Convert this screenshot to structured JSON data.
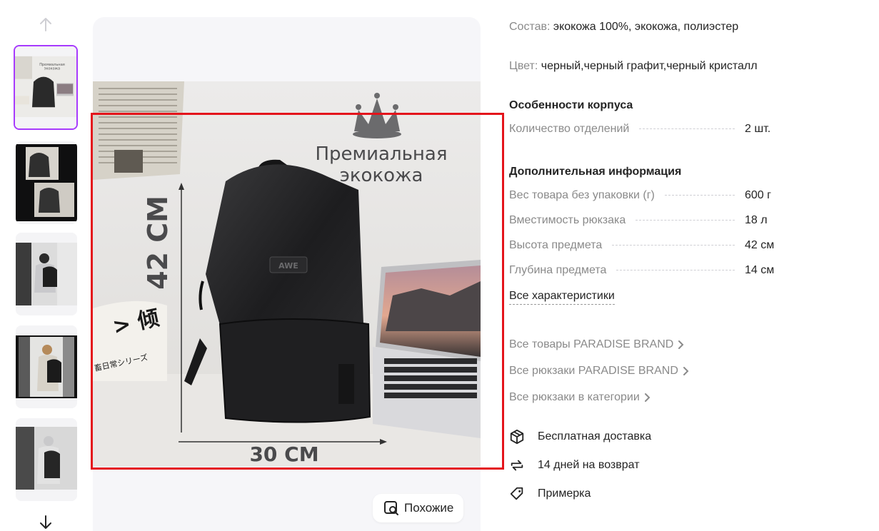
{
  "gallery": {
    "similar_label": "Похожие",
    "photo_text": {
      "headline_line1": "Премиальная",
      "headline_line2": "экокожа",
      "height_dim": "42 CM",
      "width_dim": "30 CM",
      "bag_logo": "AWE",
      "pillow_text_1": "> 倾",
      "pillow_text_2": "畜日常シリーズ"
    }
  },
  "thumbnails": [
    {
      "label": "thumbnail-1"
    },
    {
      "label": "thumbnail-2"
    },
    {
      "label": "thumbnail-3"
    },
    {
      "label": "thumbnail-4"
    },
    {
      "label": "thumbnail-5"
    }
  ],
  "specs": {
    "composition_key": "Состав:",
    "composition_value": "экокожа 100%, экокожа, полиэстер",
    "color_key": "Цвет:",
    "color_value": "черный,черный графит,черный кристалл",
    "body_section": {
      "title": "Особенности корпуса",
      "rows": [
        {
          "label": "Количество отделений",
          "value": "2 шт."
        }
      ]
    },
    "extra_section": {
      "title": "Дополнительная информация",
      "rows": [
        {
          "label": "Вес товара без упаковки (г)",
          "value": "600 г"
        },
        {
          "label": "Вместимость рюкзака",
          "value": "18 л"
        },
        {
          "label": "Высота предмета",
          "value": "42 см"
        },
        {
          "label": "Глубина предмета",
          "value": "14 см"
        }
      ]
    },
    "all_specs_link": "Все характеристики"
  },
  "brand_links": [
    "Все товары PARADISE BRAND",
    "Все рюкзаки PARADISE BRAND",
    "Все рюкзаки в категории"
  ],
  "features": [
    {
      "icon": "box-icon",
      "label": "Бесплатная доставка"
    },
    {
      "icon": "return-arrows-icon",
      "label": "14 дней на возврат"
    },
    {
      "icon": "tag-icon",
      "label": "Примерка"
    }
  ],
  "colors": {
    "accent_border": "#a73afd",
    "highlight_frame": "#e4141b",
    "muted_text": "#8a8a8a"
  }
}
